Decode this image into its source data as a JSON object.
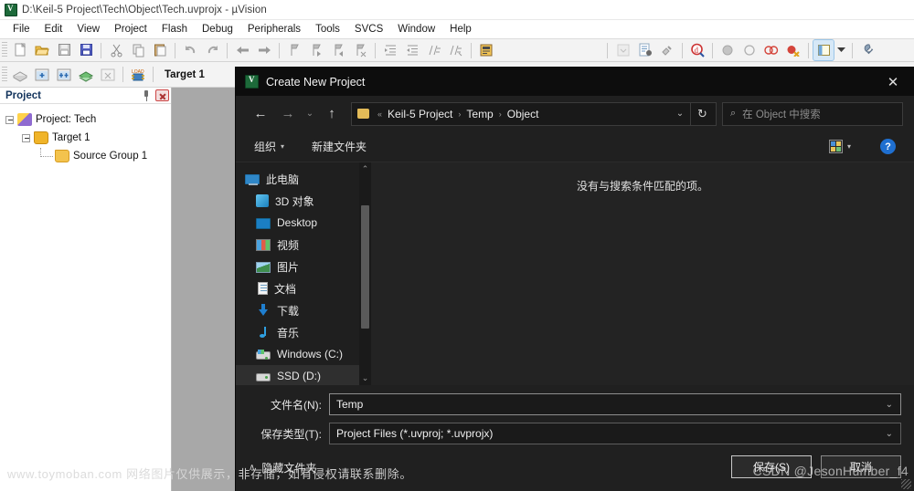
{
  "app": {
    "title": "D:\\Keil-5 Project\\Tech\\Object\\Tech.uvprojx - µVision",
    "menus": [
      "File",
      "Edit",
      "View",
      "Project",
      "Flash",
      "Debug",
      "Peripherals",
      "Tools",
      "SVCS",
      "Window",
      "Help"
    ],
    "target_label": "Target 1"
  },
  "project_panel": {
    "title": "Project",
    "tree": [
      {
        "label": "Project: Tech",
        "level": 1,
        "icon": "project-icon"
      },
      {
        "label": "Target 1",
        "level": 2,
        "icon": "target-icon"
      },
      {
        "label": "Source Group 1",
        "level": 3,
        "icon": "folder-icon"
      }
    ]
  },
  "dialog": {
    "title": "Create New Project",
    "close_label": "✕",
    "nav": {
      "back": "←",
      "forward": "→",
      "recent": "⌄",
      "up": "↑",
      "breadcrumb_prefix": "«",
      "breadcrumb": [
        "Keil-5 Project",
        "Temp",
        "Object"
      ],
      "breadcrumb_separator": "›",
      "dropdown": "⌄",
      "refresh": "↻"
    },
    "search": {
      "icon": "⌕",
      "placeholder": "在 Object 中搜索"
    },
    "toolbar": {
      "organize": "组织",
      "organize_caret": "▾",
      "new_folder": "新建文件夹",
      "view_caret": "▾",
      "help": "?"
    },
    "sidebar": [
      {
        "label": "此电脑",
        "icon": "this-pc-icon",
        "root": true
      },
      {
        "label": "3D 对象",
        "icon": "3d-objects-icon",
        "root": false
      },
      {
        "label": "Desktop",
        "icon": "desktop-icon",
        "root": false
      },
      {
        "label": "视频",
        "icon": "videos-icon",
        "root": false
      },
      {
        "label": "图片",
        "icon": "pictures-icon",
        "root": false
      },
      {
        "label": "文档",
        "icon": "documents-icon",
        "root": false
      },
      {
        "label": "下载",
        "icon": "downloads-icon",
        "root": false
      },
      {
        "label": "音乐",
        "icon": "music-icon",
        "root": false
      },
      {
        "label": "Windows (C:)",
        "icon": "windows-drive-icon",
        "root": false
      },
      {
        "label": "SSD (D:)",
        "icon": "drive-icon",
        "root": false
      }
    ],
    "file_list": {
      "empty_message": "没有与搜索条件匹配的项。"
    },
    "fields": {
      "filename_label": "文件名(N):",
      "filename_value": "Temp",
      "filetype_label": "保存类型(T):",
      "filetype_value": "Project Files (*.uvproj; *.uvprojx)",
      "caret": "⌄"
    },
    "footer": {
      "hide_folders_caret": "∧",
      "hide_folders": "隐藏文件夹",
      "save": "保存(S)",
      "cancel": "取消"
    }
  },
  "watermarks": {
    "left": "www.toymoban.com 网络图片仅供展示，非存储，如有侵权请联系删除。",
    "right": "CSDN @JesonHumber_f4"
  }
}
